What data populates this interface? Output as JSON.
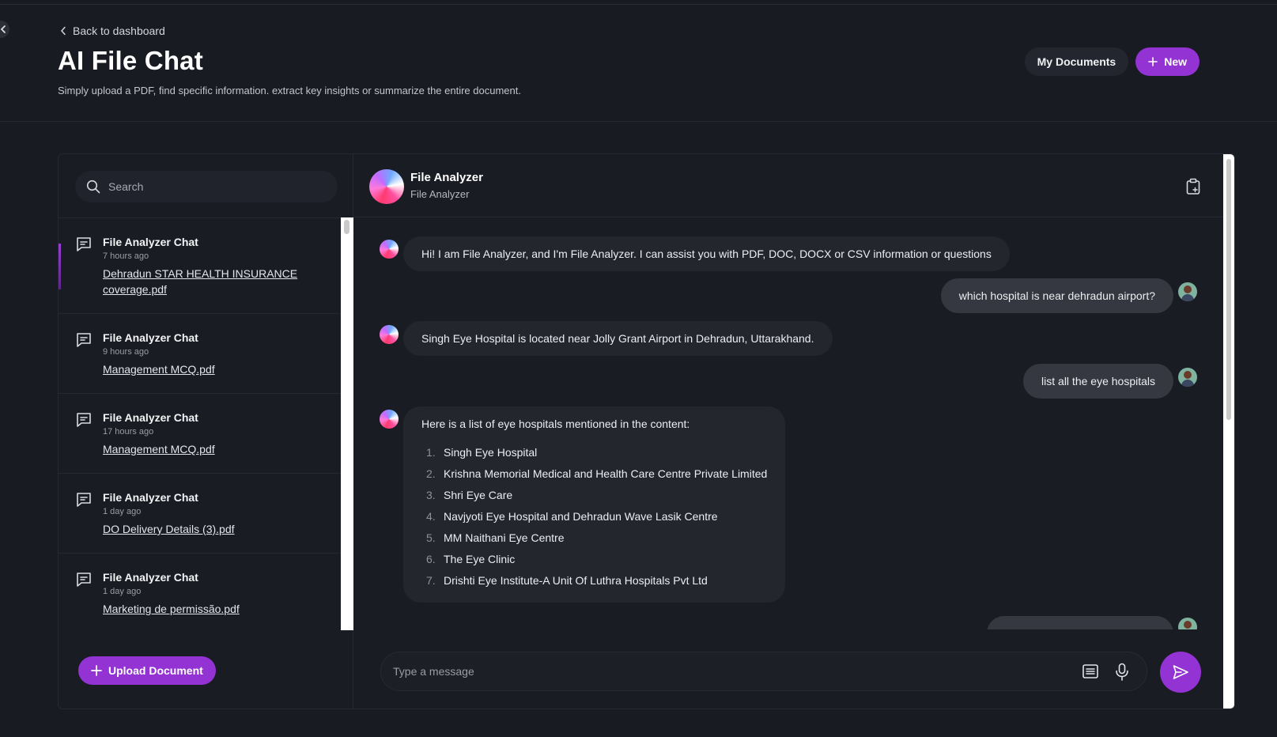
{
  "nav": {
    "back_label": "Back to dashboard"
  },
  "header": {
    "title": "AI File Chat",
    "subtitle": "Simply upload a PDF, find specific information. extract key insights or summarize the entire document.",
    "my_documents_label": "My Documents",
    "new_label": "New"
  },
  "sidebar": {
    "search_placeholder": "Search",
    "conversations": [
      {
        "title": "File Analyzer Chat",
        "time": "7 hours ago",
        "file": "Dehradun STAR HEALTH INSURANCE coverage.pdf"
      },
      {
        "title": "File Analyzer Chat",
        "time": "9 hours ago",
        "file": "Management MCQ.pdf"
      },
      {
        "title": "File Analyzer Chat",
        "time": "17 hours ago",
        "file": "Management MCQ.pdf"
      },
      {
        "title": "File Analyzer Chat",
        "time": "1 day ago",
        "file": "DO Delivery Details (3).pdf"
      },
      {
        "title": "File Analyzer Chat",
        "time": "1 day ago",
        "file": "Marketing de permissão.pdf"
      }
    ],
    "upload_label": "Upload Document"
  },
  "chat": {
    "name": "File Analyzer",
    "subtitle": "File Analyzer",
    "messages": [
      {
        "role": "bot",
        "text": "Hi! I am File Analyzer, and I'm File Analyzer. I can assist you with PDF, DOC, DOCX or CSV information or questions"
      },
      {
        "role": "user",
        "text": "which hospital is near dehradun airport?"
      },
      {
        "role": "bot",
        "text": "Singh Eye Hospital is located near Jolly Grant Airport in Dehradun, Uttarakhand."
      },
      {
        "role": "user",
        "text": "list all the eye hospitals"
      },
      {
        "role": "bot",
        "text": "Here is a list of eye hospitals mentioned in the content:",
        "list": [
          {
            "num": "1.",
            "text": "Singh Eye Hospital"
          },
          {
            "num": "2.",
            "text": "Krishna Memorial Medical and Health Care Centre Private Limited"
          },
          {
            "num": "3.",
            "text": "Shri Eye Care"
          },
          {
            "num": "4.",
            "text": "Navjyoti Eye Hospital and Dehradun Wave Lasik Centre"
          },
          {
            "num": "5.",
            "text": "MM Naithani Eye Centre"
          },
          {
            "num": "6.",
            "text": "The Eye Clinic"
          },
          {
            "num": "7.",
            "text": "Drishti Eye Institute-A Unit Of Luthra Hospitals Pvt Ltd"
          }
        ]
      }
    ],
    "input_placeholder": "Type a message"
  },
  "icons": {
    "back": "chevron-left-icon",
    "new": "plus-icon",
    "search": "search-icon",
    "conversation": "chat-bubble-icon",
    "clipboard": "clipboard-icon",
    "document": "document-lines-icon",
    "mic": "microphone-icon",
    "send": "send-icon"
  },
  "colors": {
    "background": "#191b22",
    "accent": "#9333d3",
    "bot_bubble": "#23262d",
    "user_bubble": "#353840"
  }
}
